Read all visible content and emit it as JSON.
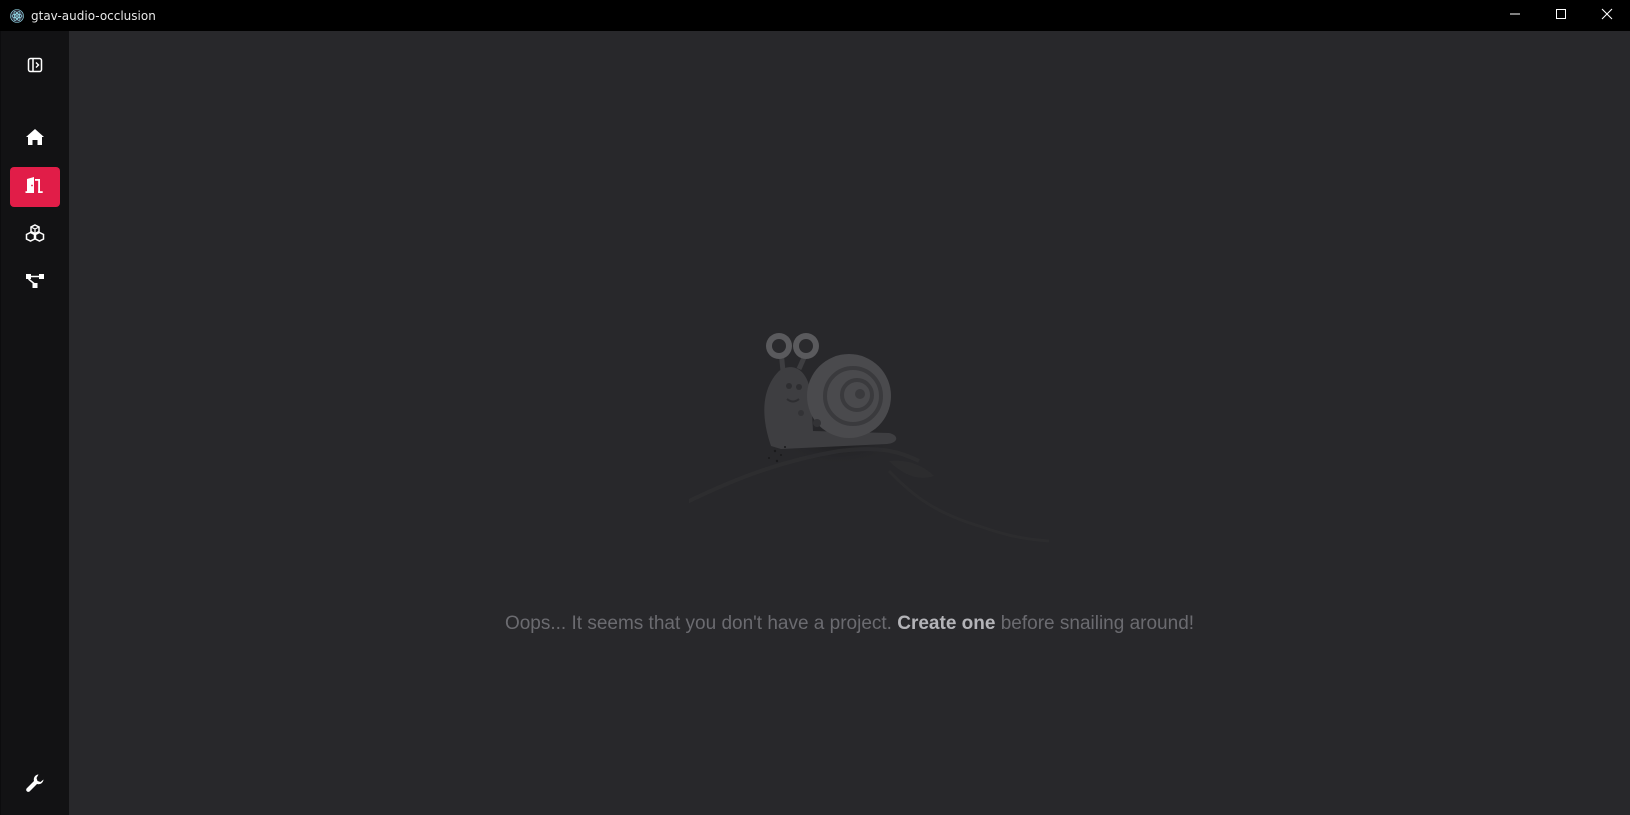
{
  "window": {
    "title": "gtav-audio-occlusion",
    "logo_icon": "electron-logo-icon",
    "controls": [
      "minimize-icon",
      "maximize-icon",
      "close-icon"
    ]
  },
  "sidebar": {
    "toggle_icon": "sidebar-toggle-icon",
    "items": [
      {
        "icon": "home-icon",
        "active": false
      },
      {
        "icon": "door-open-icon",
        "active": true
      },
      {
        "icon": "cubes-icon",
        "active": false
      },
      {
        "icon": "node-tree-icon",
        "active": false
      }
    ],
    "settings_icon": "wrench-icon"
  },
  "empty_state": {
    "illustration": "snail-illustration",
    "text_before": "Oops... It seems that you don't have a project.",
    "cta": "Create one",
    "text_after": "before snailing around!"
  },
  "colors": {
    "accent": "#e11d48",
    "sidebar_bg": "#121214",
    "main_bg": "#28282b",
    "titlebar_bg": "#000000"
  }
}
